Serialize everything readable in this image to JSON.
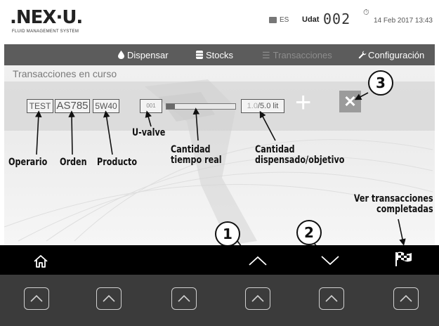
{
  "header": {
    "logo": ".NEX·U.",
    "logo_subtitle": "FLUID MANAGEMENT SYSTEM",
    "language": "ES",
    "udat_label": "Udat",
    "udat_value": "002",
    "datetime": "14 Feb 2017 13:43"
  },
  "nav": {
    "items": [
      {
        "label": "Dispensar",
        "icon": "drop-icon"
      },
      {
        "label": "Stocks",
        "icon": "barrel-icon"
      },
      {
        "label": "Transacciones",
        "icon": "list-icon",
        "disabled": true
      },
      {
        "label": "Configuración",
        "icon": "wrench-icon"
      }
    ]
  },
  "main": {
    "section_title": "Transacciones en curso",
    "transaction": {
      "operator": "TEST",
      "order": "AS785",
      "product": "5W40",
      "uvalve": "001",
      "progress": 0.12,
      "dispensed": "1.0",
      "target": "/5.0 lit"
    },
    "plus": "+",
    "close": "✕"
  },
  "annotations": {
    "operario": "Operario",
    "orden": "Orden",
    "producto": "Producto",
    "uvalve": "U-valve",
    "cantidad_real_1": "Cantidad",
    "cantidad_real_2": "tiempo real",
    "cantidad_disp_1": "Cantidad",
    "cantidad_disp_2": "dispensado/objetivo",
    "ver_1": "Ver transacciones",
    "ver_2": "completadas",
    "n1": "1",
    "n2": "2",
    "n3": "3"
  },
  "colors": {
    "nav_bg": "#5c5c5c",
    "bottom_bar": "#000000",
    "bottom_panel": "#3b3b3b"
  }
}
